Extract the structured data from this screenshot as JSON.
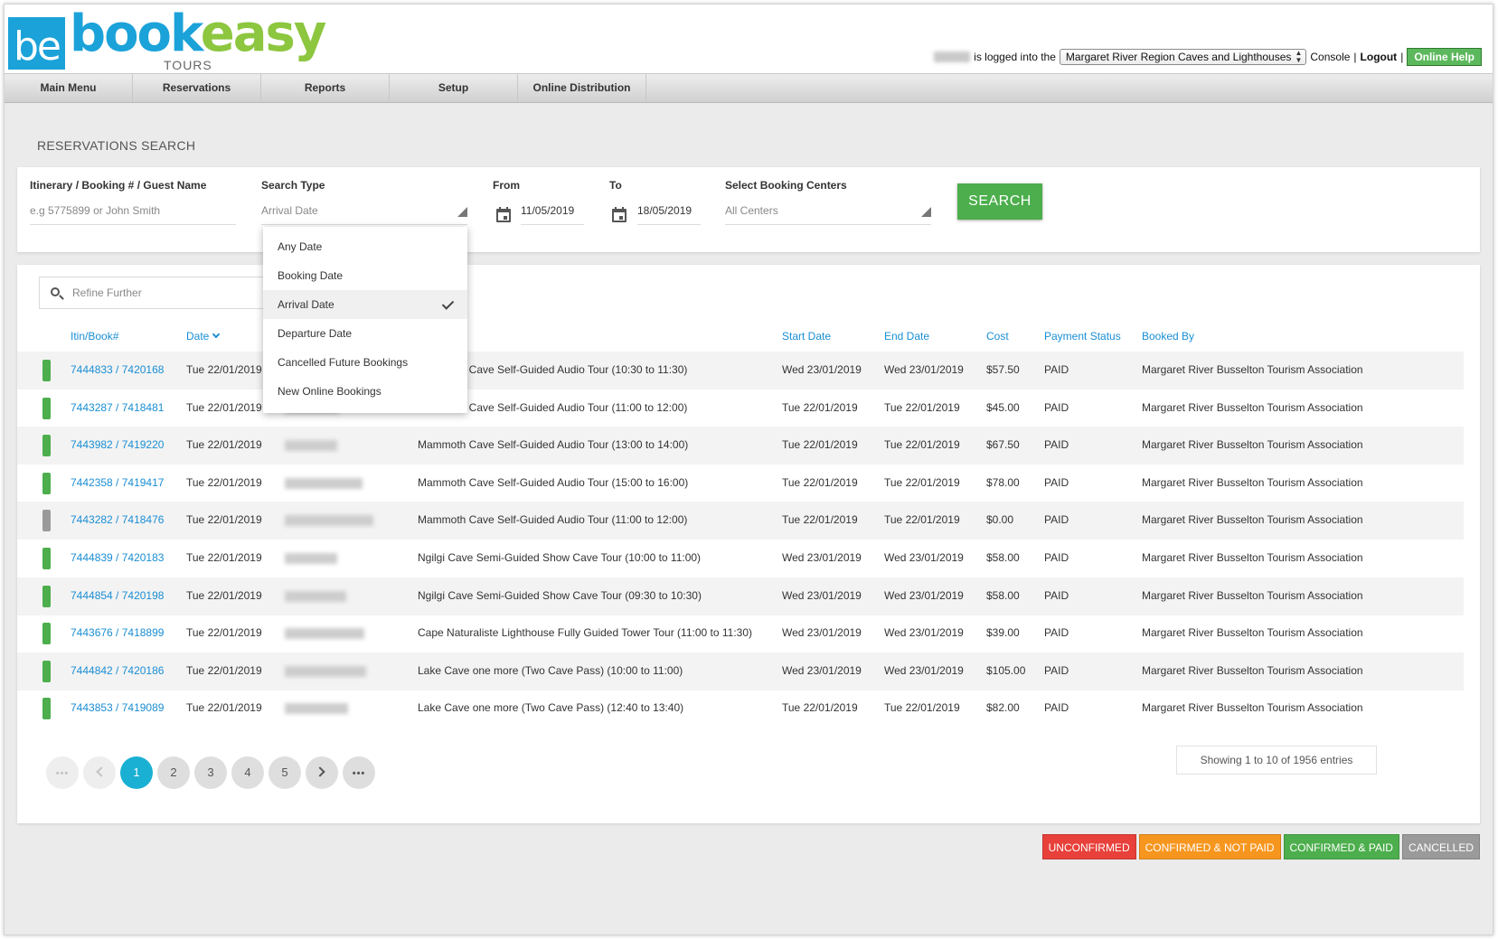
{
  "brand": {
    "mark": "be",
    "word_part1": "book",
    "word_part2": "easy",
    "sub": "TOURS"
  },
  "session": {
    "logged_text": "is logged into the",
    "property": "Margaret River Region Caves and Lighthouses",
    "console": "Console",
    "sep": "|",
    "logout": "Logout",
    "help": "Online Help"
  },
  "nav": [
    "Main Menu",
    "Reservations",
    "Reports",
    "Setup",
    "Online Distribution"
  ],
  "page_title": "RESERVATIONS SEARCH",
  "search": {
    "itinerary_label": "Itinerary / Booking # / Guest Name",
    "itinerary_placeholder": "e.g 5775899 or John Smith",
    "type_label": "Search Type",
    "type_value": "Arrival Date",
    "from_label": "From",
    "from_value": "11/05/2019",
    "to_label": "To",
    "to_value": "18/05/2019",
    "centers_label": "Select Booking Centers",
    "centers_value": "All Centers",
    "button": "SEARCH"
  },
  "dropdown": {
    "options": [
      "Any Date",
      "Booking Date",
      "Arrival Date",
      "Departure Date",
      "Cancelled Future Bookings",
      "New Online Bookings"
    ],
    "selected": "Arrival Date"
  },
  "refine_placeholder": "Refine Further",
  "columns": {
    "itin": "Itin/Book#",
    "date": "Date",
    "start": "Start Date",
    "end": "End Date",
    "cost": "Cost",
    "payment": "Payment Status",
    "booked_by": "Booked By"
  },
  "rows": [
    {
      "status": "confirmed_paid",
      "itin": "7444833 / 7420168",
      "date": "Tue 22/01/2019",
      "product": "Mammoth Cave Self-Guided Audio Tour (10:30 to 11:30)",
      "start": "Wed 23/01/2019",
      "end": "Wed 23/01/2019",
      "cost": "$57.50",
      "payment": "PAID",
      "booked_by": "Margaret River Busselton Tourism Association"
    },
    {
      "status": "confirmed_paid",
      "itin": "7443287 / 7418481",
      "date": "Tue 22/01/2019",
      "product": "Mammoth Cave Self-Guided Audio Tour (11:00 to 12:00)",
      "start": "Tue 22/01/2019",
      "end": "Tue 22/01/2019",
      "cost": "$45.00",
      "payment": "PAID",
      "booked_by": "Margaret River Busselton Tourism Association"
    },
    {
      "status": "confirmed_paid",
      "itin": "7443982 / 7419220",
      "date": "Tue 22/01/2019",
      "product": "Mammoth Cave Self-Guided Audio Tour (13:00 to 14:00)",
      "start": "Tue 22/01/2019",
      "end": "Tue 22/01/2019",
      "cost": "$67.50",
      "payment": "PAID",
      "booked_by": "Margaret River Busselton Tourism Association"
    },
    {
      "status": "confirmed_paid",
      "itin": "7442358 / 7419417",
      "date": "Tue 22/01/2019",
      "product": "Mammoth Cave Self-Guided Audio Tour (15:00 to 16:00)",
      "start": "Tue 22/01/2019",
      "end": "Tue 22/01/2019",
      "cost": "$78.00",
      "payment": "PAID",
      "booked_by": "Margaret River Busselton Tourism Association"
    },
    {
      "status": "cancelled",
      "itin": "7443282 / 7418476",
      "date": "Tue 22/01/2019",
      "product": "Mammoth Cave Self-Guided Audio Tour (11:00 to 12:00)",
      "start": "Tue 22/01/2019",
      "end": "Tue 22/01/2019",
      "cost": "$0.00",
      "payment": "PAID",
      "booked_by": "Margaret River Busselton Tourism Association"
    },
    {
      "status": "confirmed_paid",
      "itin": "7444839 / 7420183",
      "date": "Tue 22/01/2019",
      "product": "Ngilgi Cave Semi-Guided Show Cave Tour (10:00 to 11:00)",
      "start": "Wed 23/01/2019",
      "end": "Wed 23/01/2019",
      "cost": "$58.00",
      "payment": "PAID",
      "booked_by": "Margaret River Busselton Tourism Association"
    },
    {
      "status": "confirmed_paid",
      "itin": "7444854 / 7420198",
      "date": "Tue 22/01/2019",
      "product": "Ngilgi Cave Semi-Guided Show Cave Tour (09:30 to 10:30)",
      "start": "Wed 23/01/2019",
      "end": "Wed 23/01/2019",
      "cost": "$58.00",
      "payment": "PAID",
      "booked_by": "Margaret River Busselton Tourism Association"
    },
    {
      "status": "confirmed_paid",
      "itin": "7443676 / 7418899",
      "date": "Tue 22/01/2019",
      "product": "Cape Naturaliste Lighthouse Fully Guided Tower Tour (11:00 to 11:30)",
      "start": "Wed 23/01/2019",
      "end": "Wed 23/01/2019",
      "cost": "$39.00",
      "payment": "PAID",
      "booked_by": "Margaret River Busselton Tourism Association"
    },
    {
      "status": "confirmed_paid",
      "itin": "7444842 / 7420186",
      "date": "Tue 22/01/2019",
      "product": "Lake Cave one more (Two Cave Pass) (10:00 to 11:00)",
      "start": "Wed 23/01/2019",
      "end": "Wed 23/01/2019",
      "cost": "$105.00",
      "payment": "PAID",
      "booked_by": "Margaret River Busselton Tourism Association"
    },
    {
      "status": "confirmed_paid",
      "itin": "7443853 / 7419089",
      "date": "Tue 22/01/2019",
      "product": "Lake Cave one more (Two Cave Pass) (12:40 to 13:40)",
      "start": "Tue 22/01/2019",
      "end": "Tue 22/01/2019",
      "cost": "$82.00",
      "payment": "PAID",
      "booked_by": "Margaret River Busselton Tourism Association"
    }
  ],
  "pagination": {
    "pages": [
      "1",
      "2",
      "3",
      "4",
      "5"
    ],
    "current": "1",
    "showing": "Showing 1 to 10 of 1956 entries"
  },
  "legend": [
    {
      "label": "UNCONFIRMED",
      "color": "#e8403a"
    },
    {
      "label": "CONFIRMED & NOT PAID",
      "color": "#f7961e"
    },
    {
      "label": "CONFIRMED & PAID",
      "color": "#4cae4c"
    },
    {
      "label": "CANCELLED",
      "color": "#9a9a9a"
    }
  ],
  "status_colors": {
    "confirmed_paid": "#4cae4c",
    "cancelled": "#9a9a9a",
    "unconfirmed": "#e8403a",
    "confirmed_not_paid": "#f7961e"
  }
}
